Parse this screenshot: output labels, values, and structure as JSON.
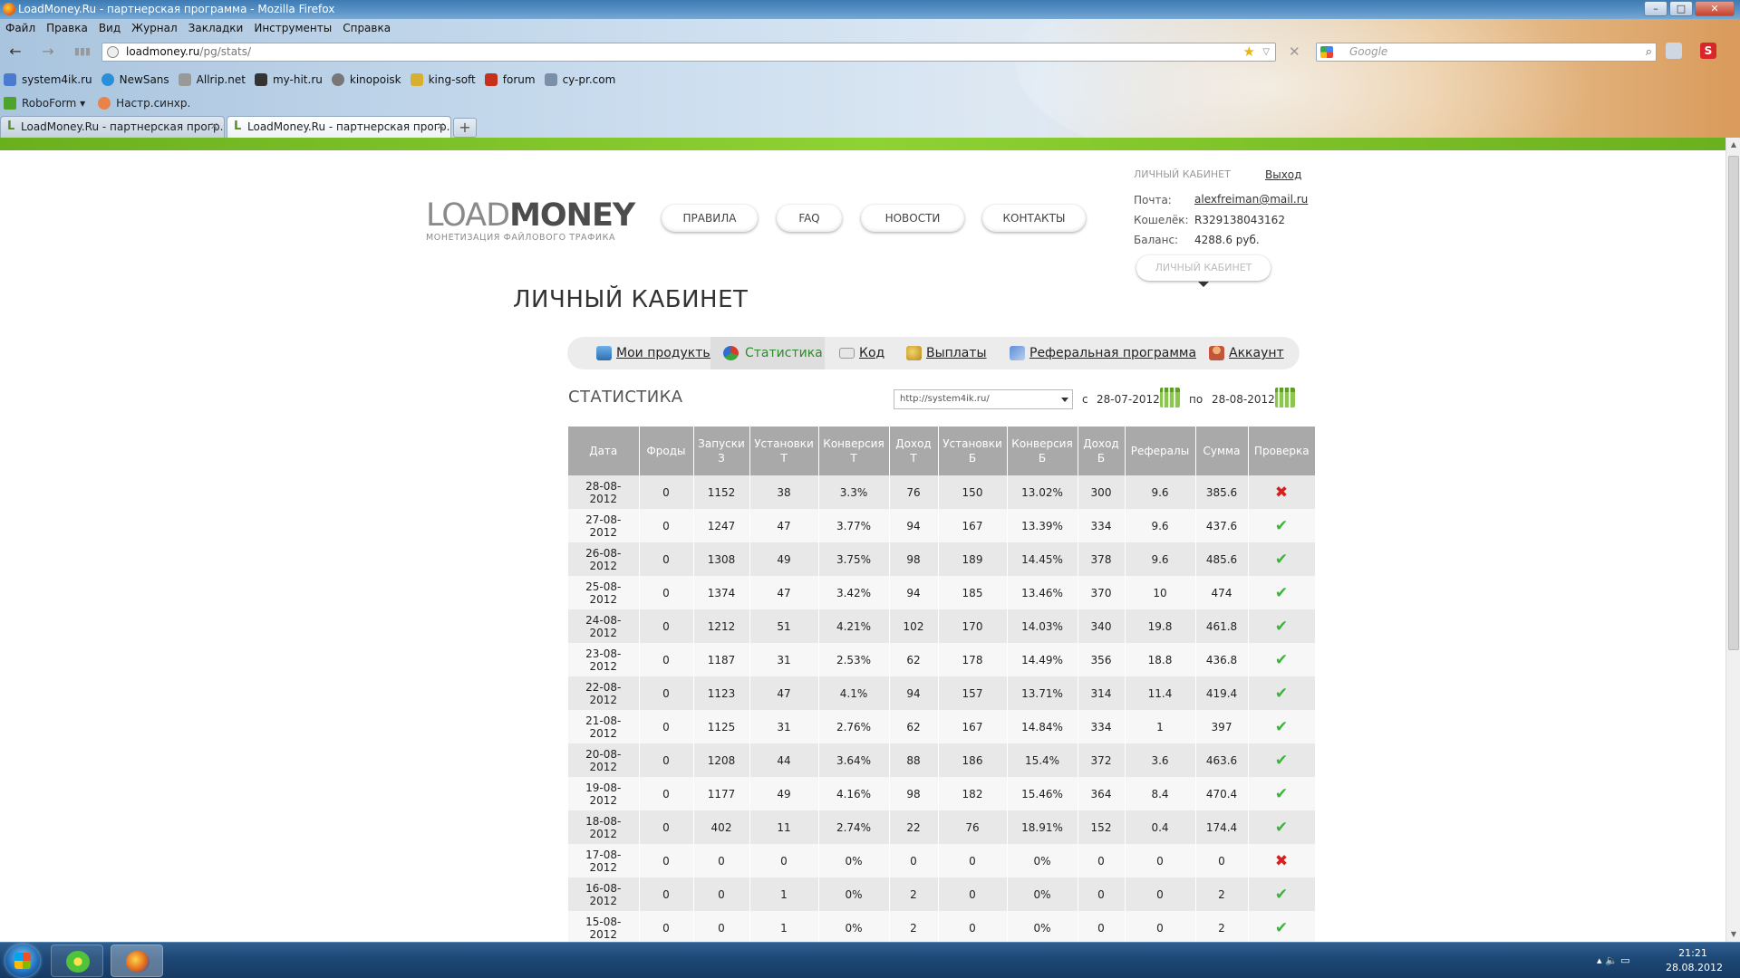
{
  "browser": {
    "title": "LoadMoney.Ru - партнерская программа - Mozilla Firefox",
    "window_controls": {
      "minimize": "–",
      "maximize": "□",
      "close": "✕"
    },
    "menu": [
      "Файл",
      "Правка",
      "Вид",
      "Журнал",
      "Закладки",
      "Инструменты",
      "Справка"
    ],
    "url_host": "loadmoney.ru",
    "url_path": "/pg/stats/",
    "search_placeholder": "Google",
    "bookmarks": [
      "system4ik.ru",
      "NewSans",
      "Allrip.net",
      "my-hit.ru",
      "kinopoisk",
      "king-soft",
      "forum",
      "cy-pr.com"
    ],
    "bookmarks2": [
      "RoboForm ▾",
      "Настр.синхр."
    ],
    "tabs": [
      {
        "title": "LoadMoney.Ru - партнерская прогр..."
      },
      {
        "title": "LoadMoney.Ru - партнерская прогр..."
      }
    ],
    "tab_favicon": "L",
    "tab_close": "✕",
    "new_tab": "+",
    "nav_glyphs": {
      "back": "←",
      "forward": "→",
      "stop": "✕",
      "star": "★",
      "drop": "▽",
      "search": "⌕"
    }
  },
  "site": {
    "logo_light": "LOAD",
    "logo_bold": "MONEY",
    "logo_sub": "МОНЕТИЗАЦИЯ ФАЙЛОВОГО ТРАФИКА",
    "nav": [
      "ПРАВИЛА",
      "FAQ",
      "НОВОСТИ",
      "КОНТАКТЫ"
    ],
    "cabinet": {
      "heading": "ЛИЧНЫЙ КАБИНЕТ",
      "logout": "Выход",
      "email_label": "Почта:",
      "email": "alexfreiman@mail.ru",
      "wallet_label": "Кошелёк:",
      "wallet": "R329138043162",
      "balance_label": "Баланс:",
      "balance": "4288.6 руб.",
      "button": "ЛИЧНЫЙ КАБИНЕТ"
    },
    "page_title": "ЛИЧНЫЙ КАБИНЕТ",
    "tabs": [
      {
        "label": "Мои продукты",
        "icon": "monitor-icon"
      },
      {
        "label": "Статистика",
        "icon": "pie-chart-icon"
      },
      {
        "label": "Код",
        "icon": "code-icon"
      },
      {
        "label": "Выплаты",
        "icon": "coins-icon"
      },
      {
        "label": "Реферальная программа",
        "icon": "flag-icon"
      },
      {
        "label": "Аккаунт",
        "icon": "user-icon"
      }
    ],
    "stats": {
      "title": "СТАТИСТИКА",
      "site_select": "http://system4ik.ru/",
      "from_label": "с",
      "from_date": "28-07-2012",
      "to_label": "по",
      "to_date": "28-08-2012",
      "columns": [
        "Дата",
        "Фроды",
        "Запуски З",
        "Установки Т",
        "Конверсия Т",
        "Доход Т",
        "Установки Б",
        "Конверсия Б",
        "Доход Б",
        "Рефералы",
        "Сумма",
        "Проверка"
      ],
      "rows": [
        [
          "28-08-2012",
          "0",
          "1152",
          "38",
          "3.3%",
          "76",
          "150",
          "13.02%",
          "300",
          "9.6",
          "385.6",
          "bad"
        ],
        [
          "27-08-2012",
          "0",
          "1247",
          "47",
          "3.77%",
          "94",
          "167",
          "13.39%",
          "334",
          "9.6",
          "437.6",
          "ok"
        ],
        [
          "26-08-2012",
          "0",
          "1308",
          "49",
          "3.75%",
          "98",
          "189",
          "14.45%",
          "378",
          "9.6",
          "485.6",
          "ok"
        ],
        [
          "25-08-2012",
          "0",
          "1374",
          "47",
          "3.42%",
          "94",
          "185",
          "13.46%",
          "370",
          "10",
          "474",
          "ok"
        ],
        [
          "24-08-2012",
          "0",
          "1212",
          "51",
          "4.21%",
          "102",
          "170",
          "14.03%",
          "340",
          "19.8",
          "461.8",
          "ok"
        ],
        [
          "23-08-2012",
          "0",
          "1187",
          "31",
          "2.53%",
          "62",
          "178",
          "14.49%",
          "356",
          "18.8",
          "436.8",
          "ok"
        ],
        [
          "22-08-2012",
          "0",
          "1123",
          "47",
          "4.1%",
          "94",
          "157",
          "13.71%",
          "314",
          "11.4",
          "419.4",
          "ok"
        ],
        [
          "21-08-2012",
          "0",
          "1125",
          "31",
          "2.76%",
          "62",
          "167",
          "14.84%",
          "334",
          "1",
          "397",
          "ok"
        ],
        [
          "20-08-2012",
          "0",
          "1208",
          "44",
          "3.64%",
          "88",
          "186",
          "15.4%",
          "372",
          "3.6",
          "463.6",
          "ok"
        ],
        [
          "19-08-2012",
          "0",
          "1177",
          "49",
          "4.16%",
          "98",
          "182",
          "15.46%",
          "364",
          "8.4",
          "470.4",
          "ok"
        ],
        [
          "18-08-2012",
          "0",
          "402",
          "11",
          "2.74%",
          "22",
          "76",
          "18.91%",
          "152",
          "0.4",
          "174.4",
          "ok"
        ],
        [
          "17-08-2012",
          "0",
          "0",
          "0",
          "0%",
          "0",
          "0",
          "0%",
          "0",
          "0",
          "0",
          "bad"
        ],
        [
          "16-08-2012",
          "0",
          "0",
          "1",
          "0%",
          "2",
          "0",
          "0%",
          "0",
          "0",
          "2",
          "ok"
        ],
        [
          "15-08-2012",
          "0",
          "0",
          "1",
          "0%",
          "2",
          "0",
          "0%",
          "0",
          "0",
          "2",
          "ok"
        ]
      ]
    }
  },
  "taskbar": {
    "time": "21:21",
    "date": "28.08.2012",
    "tray_glyphs": "▴  🔈  ▭"
  },
  "colors": {
    "green_bar": "#8fd233",
    "ok": "#3cb43c",
    "bad": "#d81f1f",
    "header_gray": "#a9a9a9"
  }
}
